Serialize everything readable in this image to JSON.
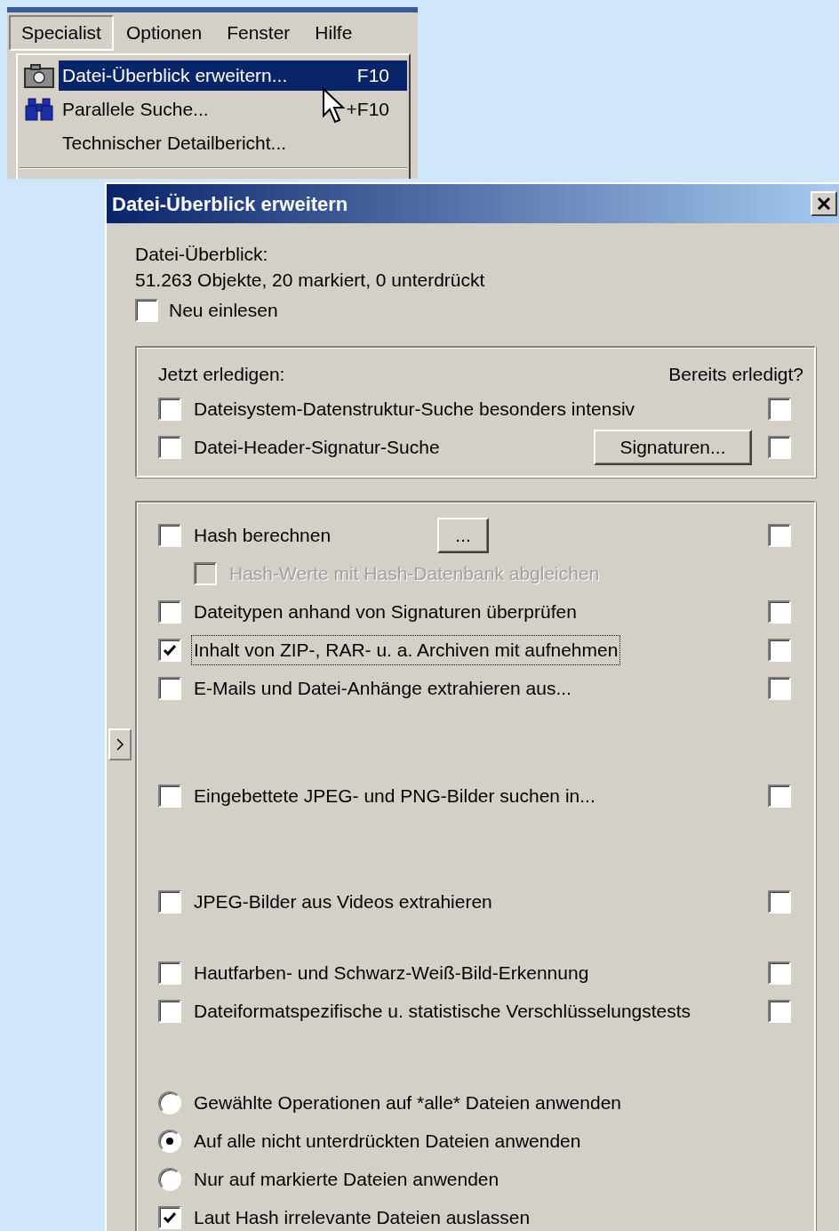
{
  "menubar": [
    {
      "label": "Specialist",
      "selected": true
    },
    {
      "label": "Optionen",
      "selected": false
    },
    {
      "label": "Fenster",
      "selected": false
    },
    {
      "label": "Hilfe",
      "selected": false
    }
  ],
  "menu": [
    {
      "kind": "camera",
      "label": "Datei-Überblick erweitern...",
      "shortcut": "F10",
      "selected": true
    },
    {
      "kind": "binoculars",
      "label": "Parallele Suche...",
      "shortcut": "+F10",
      "selected": false
    },
    {
      "kind": "plain",
      "label": "Technischer Detailbericht...",
      "selected": false
    }
  ],
  "dialog": {
    "title": "Datei-Überblick erweitern",
    "summary_label": "Datei-Überblick:",
    "summary": "51.263 Objekte, 20 markiert, 0 unterdrückt",
    "reread": {
      "label": "Neu einlesen",
      "checked": false
    },
    "group1": {
      "heading": "Jetzt erledigen:",
      "done_heading": "Bereits erledigt?",
      "rows": [
        {
          "kind": "checkbox",
          "label": "Dateisystem-Datenstruktur-Suche besonders intensiv",
          "checked": false,
          "done": false
        },
        {
          "kind": "checkbox",
          "label": "Datei-Header-Signatur-Suche",
          "checked": false,
          "done": false,
          "button": "Signaturen..."
        }
      ]
    },
    "sections": [
      {
        "rows": [
          {
            "kind": "checkbox",
            "label": "Hash berechnen",
            "checked": false,
            "done": false,
            "button": "...",
            "children": [
              {
                "kind": "checkbox",
                "label": "Hash-Werte mit Hash-Datenbank abgleichen",
                "checked": false,
                "disabled": true
              }
            ]
          },
          {
            "kind": "checkbox",
            "label": "Dateitypen anhand von Signaturen überprüfen",
            "checked": false,
            "done": false
          },
          {
            "kind": "checkbox",
            "label": "Inhalt von ZIP-, RAR- u. a. Archiven mit aufnehmen",
            "checked": true,
            "done": false,
            "focused": true
          },
          {
            "kind": "checkbox",
            "label": "E-Mails und Datei-Anhänge extrahieren aus...",
            "checked": false,
            "done": false
          }
        ]
      },
      {
        "rows": [
          {
            "kind": "checkbox",
            "label": "Eingebettete JPEG- und PNG-Bilder suchen in...",
            "checked": false,
            "done": false
          }
        ]
      },
      {
        "rows": [
          {
            "kind": "checkbox",
            "label": "JPEG-Bilder aus Videos extrahieren",
            "checked": false,
            "done": false
          }
        ]
      },
      {
        "rows": [
          {
            "kind": "checkbox",
            "label": "Hautfarben- und Schwarz-Weiß-Bild-Erkennung",
            "checked": false,
            "done": false
          },
          {
            "kind": "checkbox",
            "label": "Dateiformatspezifische u. statistische Verschlüsselungstests",
            "checked": false,
            "done": false
          }
        ]
      },
      {
        "rows": [
          {
            "kind": "radio",
            "label": "Gewählte Operationen auf *alle* Dateien anwenden",
            "selected": false
          },
          {
            "kind": "radio",
            "label": "Auf alle nicht unterdrückten Dateien anwenden",
            "selected": true
          },
          {
            "kind": "radio",
            "label": "Nur auf markierte Dateien anwenden",
            "selected": false
          },
          {
            "kind": "checkbox",
            "label": "Laut Hash irrelevante Dateien auslassen",
            "checked": true
          }
        ]
      }
    ]
  }
}
